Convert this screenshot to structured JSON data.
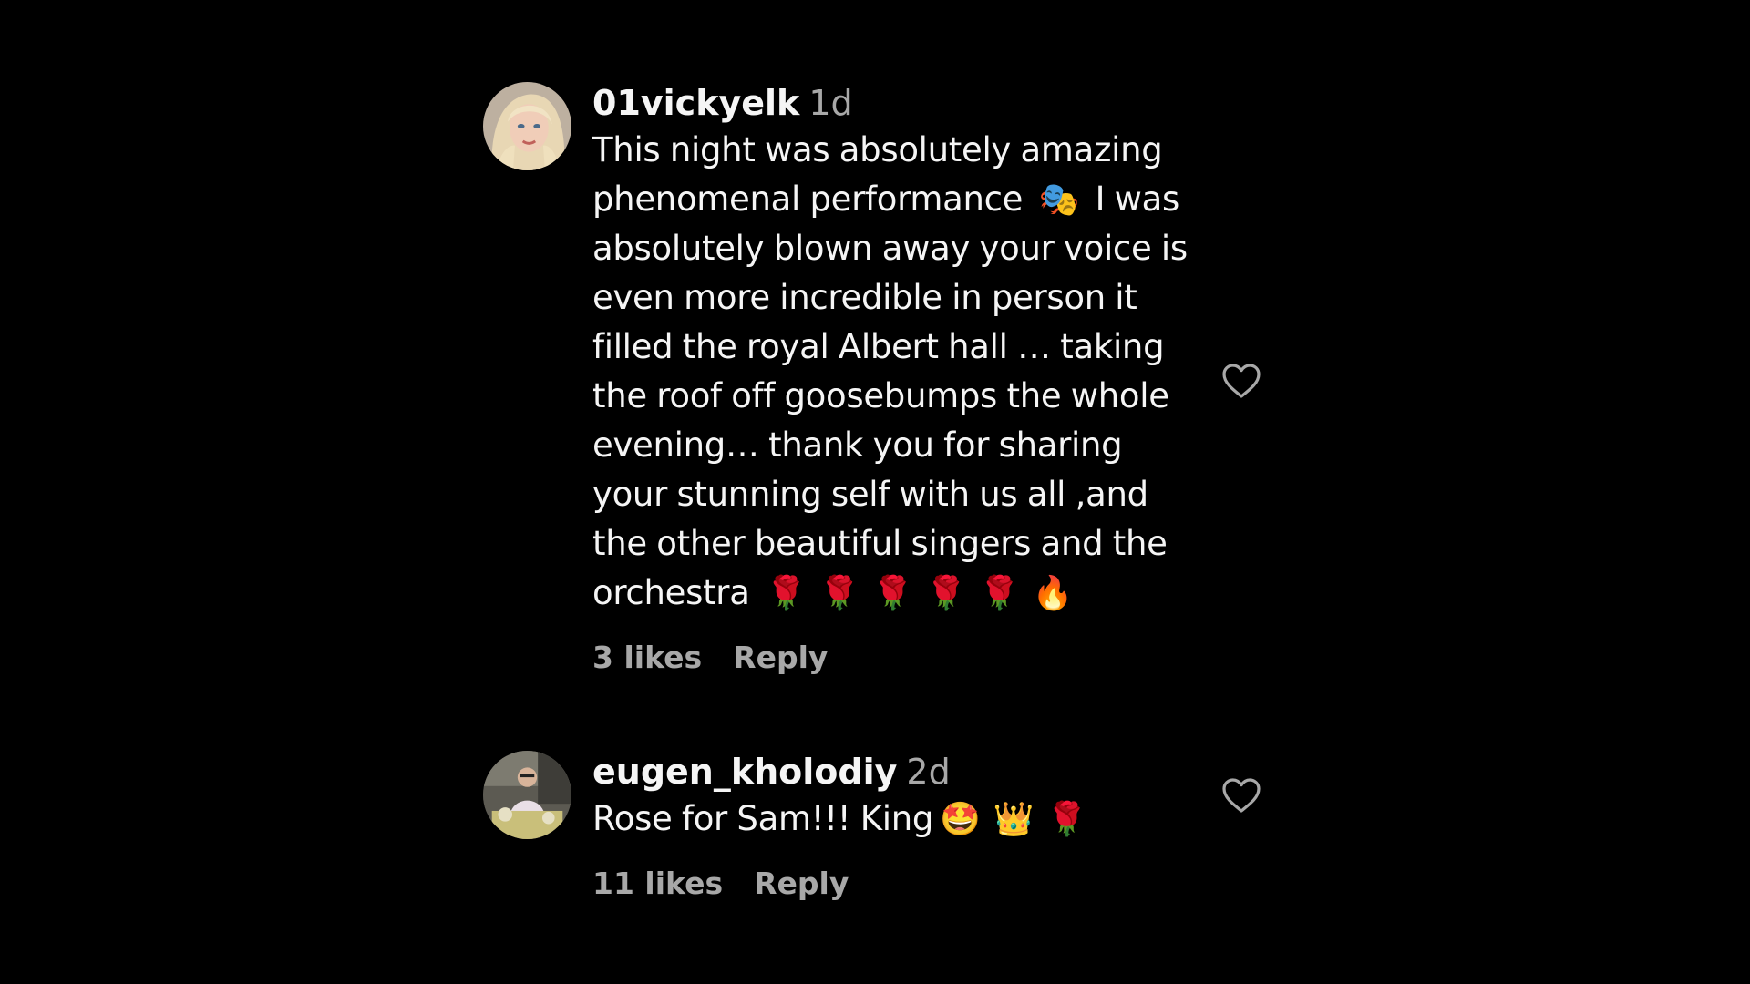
{
  "comments": [
    {
      "username": "01vickyelk",
      "age": "1d",
      "text_parts": [
        "This night was absolutely amazing phenomenal performance",
        "I was absolutely blown away your voice is even more incredible in person it filled the royal Albert hall … taking the roof off goosebumps the whole evening… thank you for sharing your stunning self with us all ,and the other beautiful singers and the orchestra"
      ],
      "emoji_1": "🎭",
      "emoji_trailing": [
        "🌹",
        "🌹",
        "🌹",
        "🌹",
        "🌹",
        "🔥"
      ],
      "likes": "3 likes",
      "reply_label": "Reply",
      "avatar_icon": "avatar-blonde-woman",
      "like_icon": "heart-outline-icon"
    },
    {
      "username": "eugen_kholodiy",
      "age": "2d",
      "text": "Rose for Sam!!! King",
      "emoji_trailing": [
        "🤩",
        "👑",
        "🌹"
      ],
      "likes": "11 likes",
      "reply_label": "Reply",
      "avatar_icon": "avatar-man-seated",
      "like_icon": "heart-outline-icon"
    }
  ],
  "colors": {
    "background": "#000000",
    "primary_text": "#f5f5f5",
    "secondary_text": "#a8a8a8",
    "icon": "#a8a8a8"
  }
}
